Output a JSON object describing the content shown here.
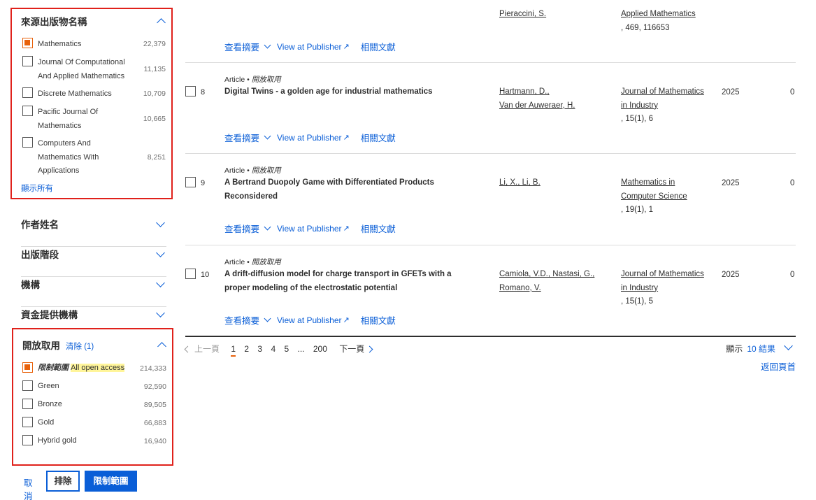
{
  "sidebar": {
    "source_facet": {
      "title": "來源出版物名稱",
      "options": [
        {
          "label": "Mathematics",
          "count": "22,379",
          "checked": true
        },
        {
          "label": "Journal Of Computational And Applied Mathematics",
          "count": "11,135",
          "checked": false
        },
        {
          "label": "Discrete Mathematics",
          "count": "10,709",
          "checked": false
        },
        {
          "label": "Pacific Journal Of Mathematics",
          "count": "10,665",
          "checked": false
        },
        {
          "label": "Computers And Mathematics With Applications",
          "count": "8,251",
          "checked": false
        }
      ],
      "show_all": "顯示所有"
    },
    "collapsed_facets": [
      {
        "label": "作者姓名"
      },
      {
        "label": "出版階段"
      },
      {
        "label": "機構"
      },
      {
        "label": "資金提供機構"
      }
    ],
    "oa_facet": {
      "title": "開放取用",
      "clear_label": "清除 (1)",
      "options": [
        {
          "label": "限制範圍",
          "highlight": "All open access",
          "count": "214,333",
          "checked": true
        },
        {
          "label": "Green",
          "count": "92,590",
          "checked": false
        },
        {
          "label": "Bronze",
          "count": "89,505",
          "checked": false
        },
        {
          "label": "Gold",
          "count": "66,883",
          "checked": false
        },
        {
          "label": "Hybrid gold",
          "count": "16,940",
          "checked": false
        }
      ]
    },
    "buttons": {
      "cancel": "取消",
      "exclude": "排除",
      "limit": "限制範圍"
    }
  },
  "results": {
    "prev_item": {
      "authors": "Pieraccini, S.",
      "source": "Applied Mathematics",
      "source_detail": ", 469, 116653"
    },
    "action_labels": {
      "abstract": "查看摘要",
      "publisher": "View at Publisher",
      "publisher_icon": "↗",
      "related": "相關文獻"
    },
    "items": [
      {
        "number": "8",
        "type": "Article",
        "access": "開放取用",
        "title": "Digital Twins - a golden age for industrial mathematics",
        "authors": [
          "Hartmann, D.,",
          "Van der Auweraer, H."
        ],
        "source": [
          "Journal of Mathematics",
          "in Industry"
        ],
        "source_detail": ", 15(1), 6",
        "year": "2025",
        "cites": "0"
      },
      {
        "number": "9",
        "type": "Article",
        "access": "開放取用",
        "title": "A Bertrand Duopoly Game with Differentiated Products Reconsidered",
        "authors": [
          "Li, X., Li, B."
        ],
        "source": [
          "Mathematics in",
          "Computer Science"
        ],
        "source_detail": ", 19(1), 1",
        "year": "2025",
        "cites": "0"
      },
      {
        "number": "10",
        "type": "Article",
        "access": "開放取用",
        "title": "A drift-diffusion model for charge transport in GFETs with a proper modeling of the electrostatic potential",
        "authors": [
          "Camiola, V.D., Nastasi, G.,",
          "Romano, V."
        ],
        "source": [
          "Journal of Mathematics",
          "in Industry"
        ],
        "source_detail": ", 15(1), 5",
        "year": "2025",
        "cites": "0"
      }
    ]
  },
  "pagination": {
    "prev": "上一頁",
    "pages": [
      "1",
      "2",
      "3",
      "4",
      "5",
      "...",
      "200"
    ],
    "current": "1",
    "next": "下一頁",
    "display_label": "顯示",
    "display_value": "10 結果",
    "back_to_top": "返回頁首"
  },
  "colors": {
    "accent": "#0a5ed7",
    "checked": "#e8610a",
    "annotation_box": "#e0211b",
    "highlight": "#fff59a"
  }
}
